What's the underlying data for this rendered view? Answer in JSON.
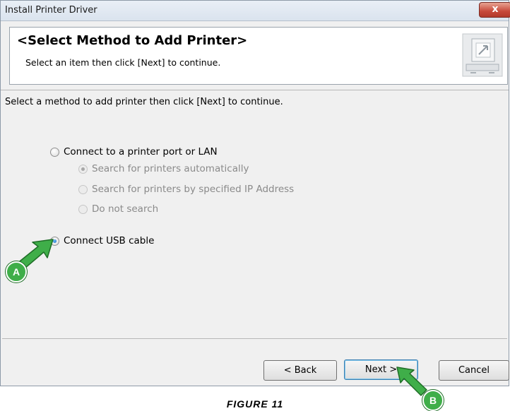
{
  "window": {
    "title": "Install Printer Driver",
    "close_label": "x"
  },
  "header": {
    "title": "<Select Method to Add Printer>",
    "subtitle": "Select an item then click [Next] to continue."
  },
  "instruction": "Select a method to add printer then click [Next] to continue.",
  "options": {
    "port_lan": {
      "label": "Connect to a printer port or LAN",
      "checked": false
    },
    "search_auto": {
      "label": "Search for printers automatically",
      "checked": true,
      "disabled": true
    },
    "search_ip": {
      "label": "Search for printers by specified IP Address",
      "checked": false,
      "disabled": true
    },
    "no_search": {
      "label": "Do not search",
      "checked": false,
      "disabled": true
    },
    "usb": {
      "label": "Connect USB cable",
      "checked": true
    }
  },
  "buttons": {
    "back": "< Back",
    "next": "Next >",
    "cancel": "Cancel"
  },
  "callouts": {
    "a": "A",
    "b": "B"
  },
  "colors": {
    "callout_green": "#3fae49",
    "title_bar": "#dae3ee",
    "close_red": "#c7493a"
  },
  "caption": "FIGURE 11"
}
